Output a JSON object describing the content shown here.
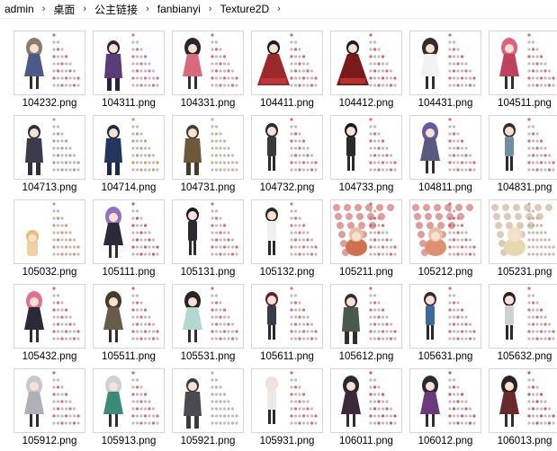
{
  "breadcrumb": {
    "items": [
      "admin",
      "桌面",
      "公主链接",
      "fanbianyi",
      "Texture2D"
    ],
    "separator": "›"
  },
  "files": [
    {
      "name": "104232.png",
      "style": "girl",
      "hair": "#8b7b6e",
      "outfit": "#4b5a86",
      "accent": "#c94a4a"
    },
    {
      "name": "104311.png",
      "style": "dark",
      "hair": "#2a2140",
      "outfit": "#5a3c7a",
      "accent": "#c84a8a"
    },
    {
      "name": "104331.png",
      "style": "girl",
      "hair": "#2a2430",
      "outfit": "#d86a7a",
      "accent": "#c94a4a"
    },
    {
      "name": "104411.png",
      "style": "wide",
      "hair": "#1e1a1a",
      "outfit": "#9a2a2a",
      "accent": "#d43b3b"
    },
    {
      "name": "104412.png",
      "style": "wide",
      "hair": "#1e1a1a",
      "outfit": "#7a1a1a",
      "accent": "#d43b3b"
    },
    {
      "name": "104431.png",
      "style": "girl",
      "hair": "#3a2a2a",
      "outfit": "#f2f2f2",
      "accent": "#c94a4a"
    },
    {
      "name": "104511.png",
      "style": "girl",
      "hair": "#e06080",
      "outfit": "#c04060",
      "accent": "#c94a4a"
    },
    {
      "name": "104713.png",
      "style": "dark",
      "hair": "#303040",
      "outfit": "#3a3a4a",
      "accent": "#8a8aa0"
    },
    {
      "name": "104714.png",
      "style": "dark",
      "hair": "#1a2a50",
      "outfit": "#24365e",
      "accent": "#b08a40"
    },
    {
      "name": "104731.png",
      "style": "dark",
      "hair": "#4a3a2a",
      "outfit": "#6a5a3a",
      "accent": "#c0a060"
    },
    {
      "name": "104732.png",
      "style": "thin",
      "hair": "#2a2a2a",
      "outfit": "#3a3a3a",
      "accent": "#c94a4a"
    },
    {
      "name": "104733.png",
      "style": "thin",
      "hair": "#1a1a1a",
      "outfit": "#2a2a2a",
      "accent": "#c94a4a"
    },
    {
      "name": "104811.png",
      "style": "girl",
      "hair": "#6a5aa0",
      "outfit": "#5a5a80",
      "accent": "#c94a4a"
    },
    {
      "name": "104831.png",
      "style": "thin",
      "hair": "#3a2a2a",
      "outfit": "#7090a0",
      "accent": "#c94a4a"
    },
    {
      "name": "105032.png",
      "style": "tiny",
      "hair": "#e8c070",
      "outfit": "#f0d0a0",
      "accent": "#d08040"
    },
    {
      "name": "105111.png",
      "style": "girl",
      "hair": "#9070c0",
      "outfit": "#2a2a3a",
      "accent": "#c03040"
    },
    {
      "name": "105131.png",
      "style": "thin",
      "hair": "#1a1a20",
      "outfit": "#2a2a30",
      "accent": "#c94a4a"
    },
    {
      "name": "105132.png",
      "style": "thin",
      "hair": "#2a2a2a",
      "outfit": "#f0f0f0",
      "accent": "#d05050"
    },
    {
      "name": "105211.png",
      "style": "busy",
      "hair": "#e8c0a0",
      "outfit": "#d07050",
      "accent": "#c94a4a"
    },
    {
      "name": "105212.png",
      "style": "busy",
      "hair": "#e8c0a0",
      "outfit": "#e09070",
      "accent": "#c94a4a"
    },
    {
      "name": "105231.png",
      "style": "busy",
      "hair": "#f0e0c0",
      "outfit": "#e8d8b0",
      "accent": "#c0a080"
    },
    {
      "name": "105432.png",
      "style": "girl",
      "hair": "#e07090",
      "outfit": "#2a2a3a",
      "accent": "#c94a4a"
    },
    {
      "name": "105511.png",
      "style": "girl",
      "hair": "#4a3a2a",
      "outfit": "#6a5a4a",
      "accent": "#c94a4a"
    },
    {
      "name": "105531.png",
      "style": "girl",
      "hair": "#2a2420",
      "outfit": "#b0d8d0",
      "accent": "#c94a4a"
    },
    {
      "name": "105611.png",
      "style": "thin",
      "hair": "#6a1a2a",
      "outfit": "#3a3a4a",
      "accent": "#c94a4a"
    },
    {
      "name": "105612.png",
      "style": "dark",
      "hair": "#3a2a2a",
      "outfit": "#4a5a4a",
      "accent": "#c94a4a"
    },
    {
      "name": "105631.png",
      "style": "thin",
      "hair": "#3a2a2a",
      "outfit": "#3a6aa0",
      "accent": "#c94a4a"
    },
    {
      "name": "105632.png",
      "style": "thin",
      "hair": "#2a2020",
      "outfit": "#d0d0d0",
      "accent": "#c94a4a"
    },
    {
      "name": "105912.png",
      "style": "girl",
      "hair": "#c8c8d0",
      "outfit": "#b0b0b8",
      "accent": "#c94a4a"
    },
    {
      "name": "105913.png",
      "style": "girl",
      "hair": "#d0d0d8",
      "outfit": "#3a8a7a",
      "accent": "#c94a4a"
    },
    {
      "name": "105921.png",
      "style": "dark",
      "hair": "#3a3a40",
      "outfit": "#4a4a50",
      "accent": "#a0a0a8"
    },
    {
      "name": "105931.png",
      "style": "thin",
      "hair": "#e8e0e0",
      "outfit": "#f0e8e8",
      "accent": "#c94a4a"
    },
    {
      "name": "106011.png",
      "style": "girl",
      "hair": "#2a2a2a",
      "outfit": "#3a2a3a",
      "accent": "#c03040"
    },
    {
      "name": "106012.png",
      "style": "girl",
      "hair": "#2a2a30",
      "outfit": "#6a3a7a",
      "accent": "#c03040"
    },
    {
      "name": "106013.png",
      "style": "girl",
      "hair": "#2a2020",
      "outfit": "#6a2a2a",
      "accent": "#c03040"
    }
  ]
}
